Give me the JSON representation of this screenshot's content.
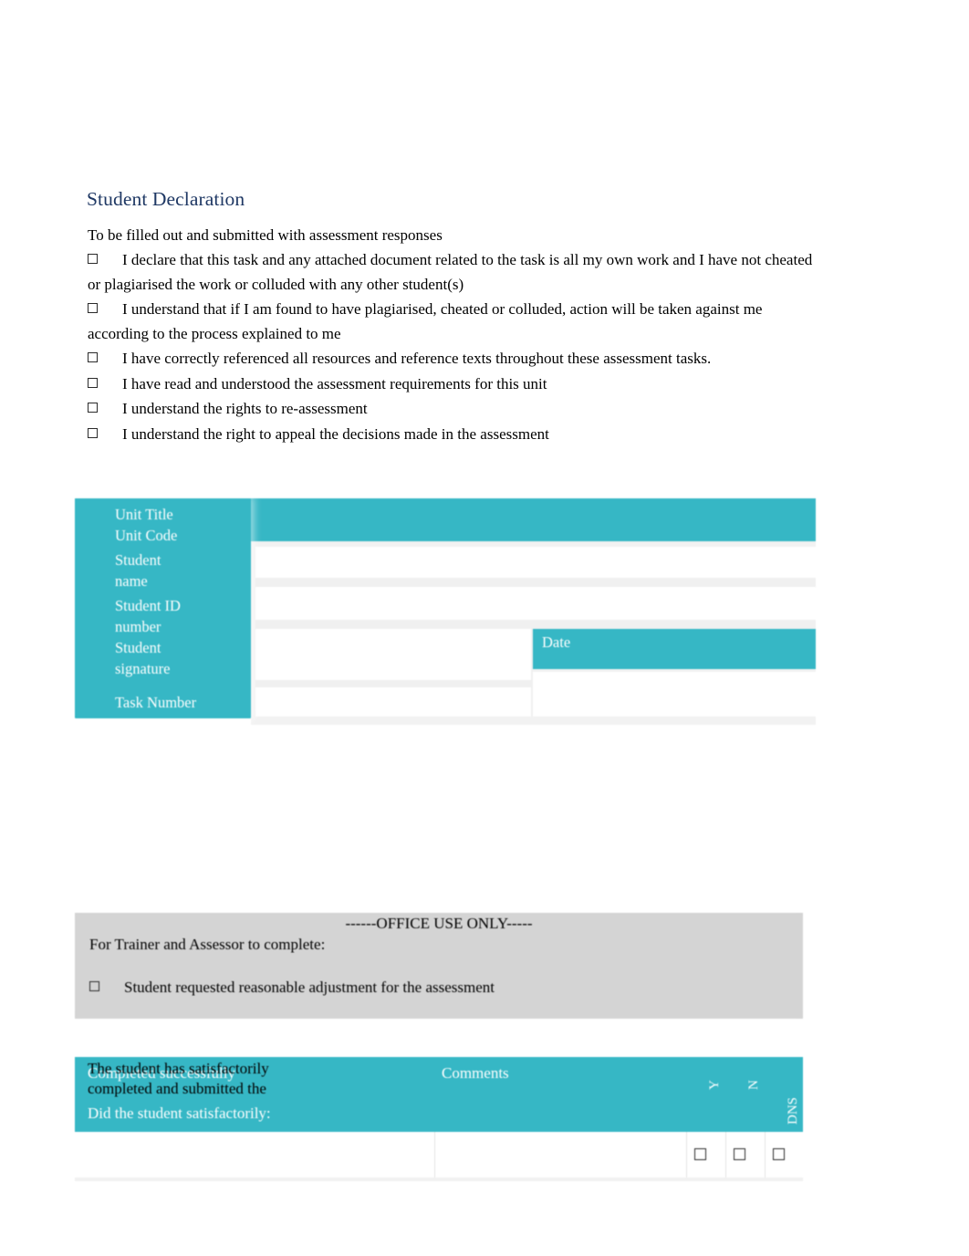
{
  "document": {
    "title": "Student Declaration",
    "intro": "To be filled out and submitted with assessment responses"
  },
  "declarations": [
    "I declare that this task and any attached document related to the task is all my own work and I have not cheated or plagiarised the work or colluded with any other student(s)",
    "I understand that if I am found to have plagiarised, cheated or colluded, action will be taken against me according to the process explained to me",
    "I have correctly referenced all resources and reference texts throughout these assessment tasks.",
    "I have read and understood the assessment requirements for this unit",
    "I understand the rights to re-assessment",
    "I understand the right to appeal the decisions made in the assessment"
  ],
  "details_table": {
    "unit_title": "Unit Title",
    "unit_code": "Unit Code",
    "student_name": "Student name",
    "student_id": "Student ID number",
    "student_signature": "Student signature",
    "date": "Date",
    "task_number": "Task Number",
    "values": {
      "unit_title": "",
      "unit_code": "",
      "student_name": "",
      "student_id": "",
      "student_signature": "",
      "date": "",
      "task_number": ""
    }
  },
  "office_use": {
    "banner": "------OFFICE USE ONLY-----",
    "subtitle": "For Trainer and Assessor to complete:",
    "checkbox_label": "Student requested reasonable adjustment for the assessment"
  },
  "assessment_table": {
    "col_completed": "Completed successfully",
    "col_did": "Did the student satisfactorily:",
    "col_comments": "Comments",
    "col_y": "Y",
    "col_n": "N",
    "col_dns": "DNS",
    "rows": [
      {
        "criterion": "The student has satisfactorily completed and submitted the",
        "comment": ""
      }
    ]
  },
  "colors": {
    "teal": "#36B7C5",
    "gray_box": "#D4D4D4",
    "heading_navy": "#1F3864",
    "text_black": "#000000",
    "white": "#FFFFFF"
  }
}
